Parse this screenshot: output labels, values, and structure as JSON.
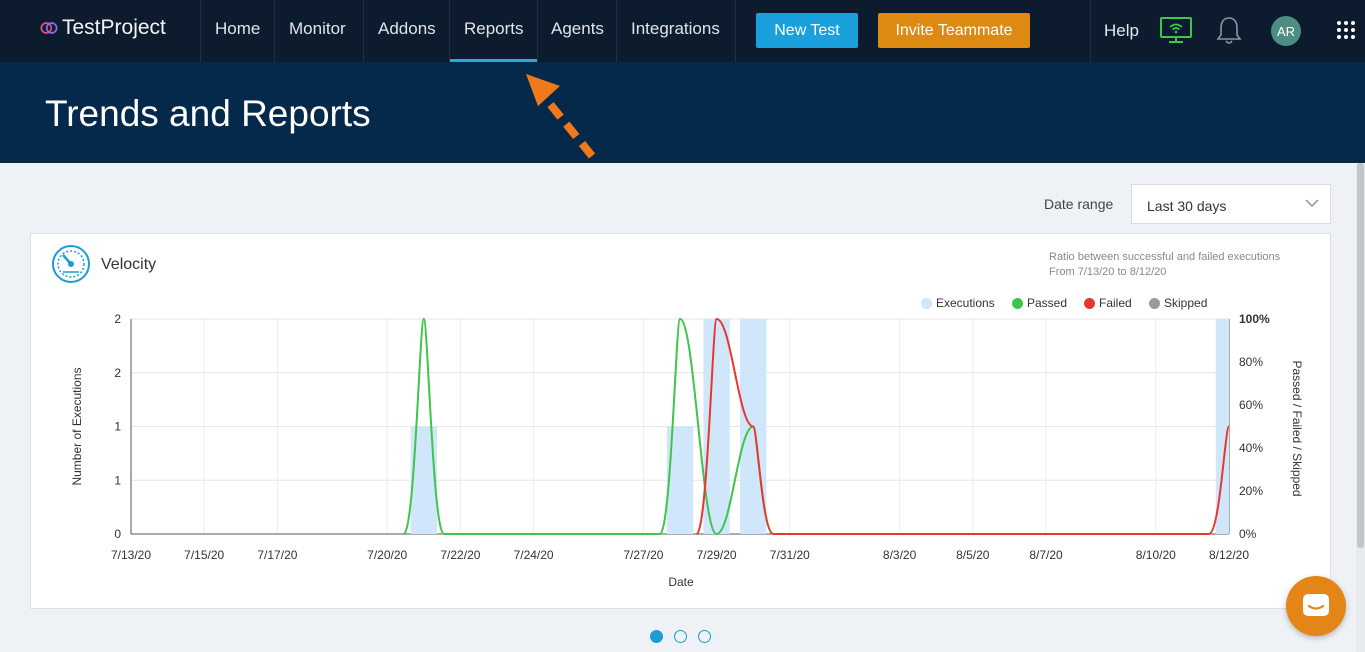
{
  "app": {
    "logo_text": "TestProject"
  },
  "nav": {
    "items": [
      {
        "label": "Home"
      },
      {
        "label": "Monitor"
      },
      {
        "label": "Addons"
      },
      {
        "label": "Reports",
        "active": true
      },
      {
        "label": "Agents"
      },
      {
        "label": "Integrations"
      }
    ]
  },
  "header": {
    "new_test": "New Test",
    "invite": "Invite Teammate",
    "help": "Help",
    "avatar": "AR",
    "icons": [
      "monitor-wifi-icon",
      "bell-icon",
      "apps-grid-icon"
    ]
  },
  "page": {
    "title": "Trends and Reports"
  },
  "filters": {
    "date_range_label": "Date range",
    "date_range_value": "Last 30 days"
  },
  "card": {
    "title": "Velocity",
    "subtitle_line1": "Ratio between successful and failed executions",
    "subtitle_line2": "From 7/13/20 to 8/12/20"
  },
  "colors": {
    "executions": "#cfe6fb",
    "passed": "#3ec54a",
    "failed": "#e8372b",
    "skipped": "#9b9b9b",
    "accent": "#1aa0dc",
    "invite": "#dd8a12"
  },
  "chart_data": {
    "type": "bar",
    "xlabel": "Date",
    "ylabel_left": "Number of Executions",
    "ylabel_right": "Passed / Failed / Skipped",
    "x_ticks": [
      "7/13/20",
      "7/15/20",
      "7/17/20",
      "7/20/20",
      "7/22/20",
      "7/24/20",
      "7/27/20",
      "7/29/20",
      "7/31/20",
      "8/3/20",
      "8/5/20",
      "8/7/20",
      "8/10/20",
      "8/12/20"
    ],
    "y_left_ticks": [
      "0",
      "1",
      "1",
      "2",
      "2"
    ],
    "y_right_ticks": [
      "0%",
      "20%",
      "40%",
      "60%",
      "80%",
      "100%"
    ],
    "ylim_left": [
      0,
      2
    ],
    "ylim_right": [
      0,
      100
    ],
    "legend": [
      "Executions",
      "Passed",
      "Failed",
      "Skipped"
    ],
    "legend_position": "top-right",
    "series": [
      {
        "name": "Executions",
        "kind": "bar",
        "points": [
          {
            "x": "7/21/20",
            "y": 1
          },
          {
            "x": "7/28/20",
            "y": 1
          },
          {
            "x": "7/29/20",
            "y": 2
          },
          {
            "x": "7/30/20",
            "y": 2
          },
          {
            "x": "8/12/20",
            "y": 2
          }
        ]
      },
      {
        "name": "Passed",
        "kind": "line",
        "points": [
          {
            "x": "7/21/20",
            "y": 100
          },
          {
            "x": "7/28/20",
            "y": 100
          },
          {
            "x": "7/29/20",
            "y": 0
          },
          {
            "x": "7/30/20",
            "y": 50
          }
        ]
      },
      {
        "name": "Failed",
        "kind": "line",
        "points": [
          {
            "x": "7/29/20",
            "y": 100
          },
          {
            "x": "7/30/20",
            "y": 50
          },
          {
            "x": "8/12/20",
            "y": 50
          }
        ]
      }
    ]
  },
  "pager": {
    "count": 3,
    "active": 0
  }
}
